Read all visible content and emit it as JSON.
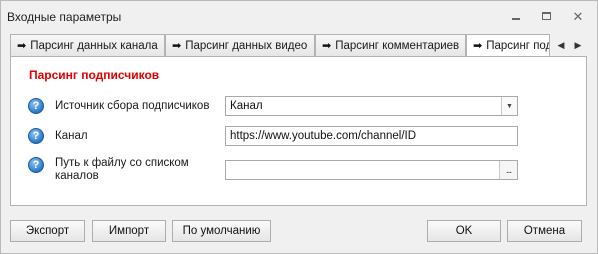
{
  "window": {
    "title": "Входные параметры",
    "controls": [
      "minimize-icon",
      "maximize-icon",
      "close-icon"
    ]
  },
  "tabs": [
    {
      "arrow": "➡",
      "label": "Парсинг данных канала"
    },
    {
      "arrow": "➡",
      "label": "Парсинг данных видео"
    },
    {
      "arrow": "➡",
      "label": "Парсинг комментариев"
    },
    {
      "arrow": "➡",
      "label": "Парсинг подписчиков"
    }
  ],
  "tab_nav": {
    "prev": "◀",
    "next": "▶"
  },
  "section": {
    "title": "Парсинг подписчиков"
  },
  "rows": [
    {
      "help": "?",
      "label": "Источник сбора подписчиков",
      "value": "Канал",
      "kind": "select"
    },
    {
      "help": "?",
      "label": "Канал",
      "value": "https://www.youtube.com/channel/ID",
      "kind": "text"
    },
    {
      "help": "?",
      "label": "Путь к файлу со списком каналов",
      "value": "",
      "kind": "file"
    }
  ],
  "select_arrow": "▼",
  "browse_label": "...",
  "buttons": {
    "export": "Экспорт",
    "import": "Импорт",
    "defaults": "По умолчанию",
    "ok": "OK",
    "cancel": "Отмена"
  },
  "colors": {
    "section_title": "#e00000",
    "help_icon": "#2a78c9"
  }
}
